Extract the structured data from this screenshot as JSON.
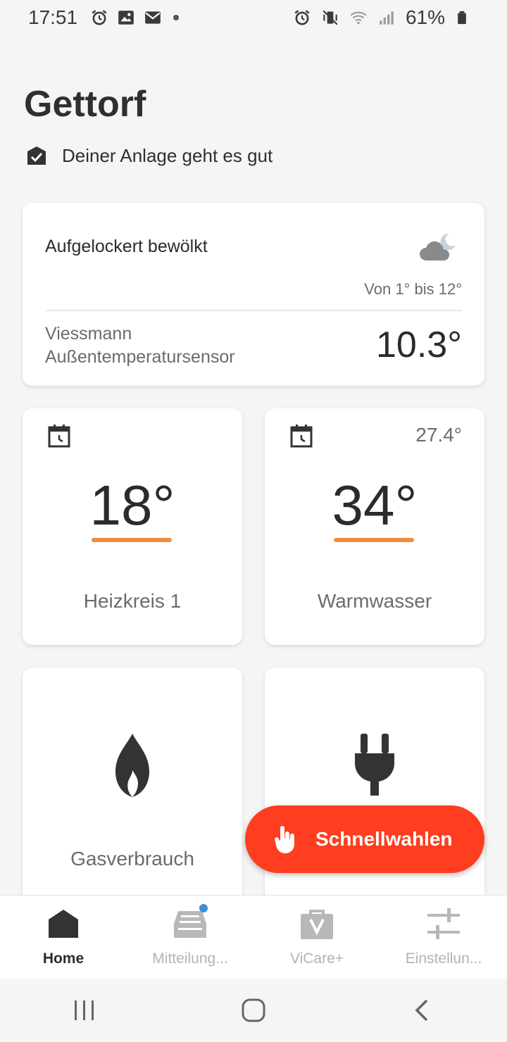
{
  "statusbar": {
    "time": "17:51",
    "battery": "61%"
  },
  "header": {
    "title": "Gettorf",
    "status_text": "Deiner Anlage geht es gut"
  },
  "weather": {
    "condition": "Aufgelockert bewölkt",
    "range": "Von 1° bis 12°",
    "sensor_line1": "Viessmann",
    "sensor_line2": "Außentemperatursensor",
    "outside_temp": "10.3°",
    "icon": "cloud-moon-icon"
  },
  "tiles": [
    {
      "name": "Heizkreis 1",
      "value": "18°",
      "aux": "",
      "icon": "calendar-clock-icon"
    },
    {
      "name": "Warmwasser",
      "value": "34°",
      "aux": "27.4°",
      "icon": "calendar-clock-icon"
    },
    {
      "name": "Gasverbrauch",
      "icon": "flame-icon"
    },
    {
      "name": "",
      "icon": "plug-icon"
    }
  ],
  "fab": {
    "label": "Schnellwahlen",
    "icon": "hand-pointer-icon"
  },
  "bottomnav": [
    {
      "label": "Home",
      "icon": "home-icon",
      "active": true
    },
    {
      "label": "Mitteilung...",
      "icon": "inbox-icon",
      "badge": true
    },
    {
      "label": "ViCare+",
      "icon": "bag-icon"
    },
    {
      "label": "Einstellun...",
      "icon": "sliders-icon"
    }
  ],
  "colors": {
    "accent_bar": "#f08d3e",
    "fab": "#ff3d1f",
    "badge": "#3a8fd8"
  }
}
